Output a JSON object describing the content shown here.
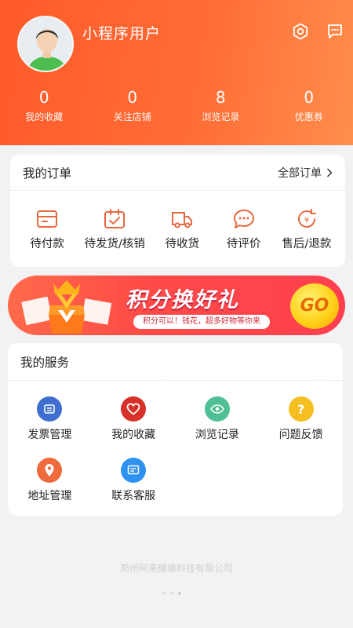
{
  "header": {
    "username": "小程序用户",
    "stats": [
      {
        "value": "0",
        "label": "我的收藏"
      },
      {
        "value": "0",
        "label": "关注店铺"
      },
      {
        "value": "8",
        "label": "浏览记录"
      },
      {
        "value": "0",
        "label": "优惠券"
      }
    ],
    "icons": {
      "settings": "settings-icon",
      "message": "message-icon"
    }
  },
  "orders": {
    "title": "我的订单",
    "all_label": "全部订单",
    "items": [
      {
        "label": "待付款",
        "icon": "wallet-icon"
      },
      {
        "label": "待发货/核销",
        "icon": "calendar-check-icon"
      },
      {
        "label": "待收货",
        "icon": "truck-icon"
      },
      {
        "label": "待评价",
        "icon": "comment-icon"
      },
      {
        "label": "售后/退款",
        "icon": "refund-icon"
      }
    ]
  },
  "banner": {
    "title": "积分换好礼",
    "subtitle": "积分可以！钱花，超多好物等你来",
    "go": "GO"
  },
  "services": {
    "title": "我的服务",
    "items": [
      {
        "label": "发票管理",
        "icon": "invoice-icon",
        "color": "#3e6fd0"
      },
      {
        "label": "我的收藏",
        "icon": "heart-icon",
        "color": "#d7312a"
      },
      {
        "label": "浏览记录",
        "icon": "eye-icon",
        "color": "#4fbf95"
      },
      {
        "label": "问题反馈",
        "icon": "question-icon",
        "color": "#f6bf21"
      },
      {
        "label": "地址管理",
        "icon": "location-icon",
        "color": "#ef6a3d"
      },
      {
        "label": "联系客服",
        "icon": "chat-service-icon",
        "color": "#2f92f0"
      }
    ]
  },
  "footer": {
    "company": "郑州阿来健康科技有限公司"
  },
  "colors": {
    "accent": "#ff5a2a",
    "icon_orange": "#e8683f"
  }
}
